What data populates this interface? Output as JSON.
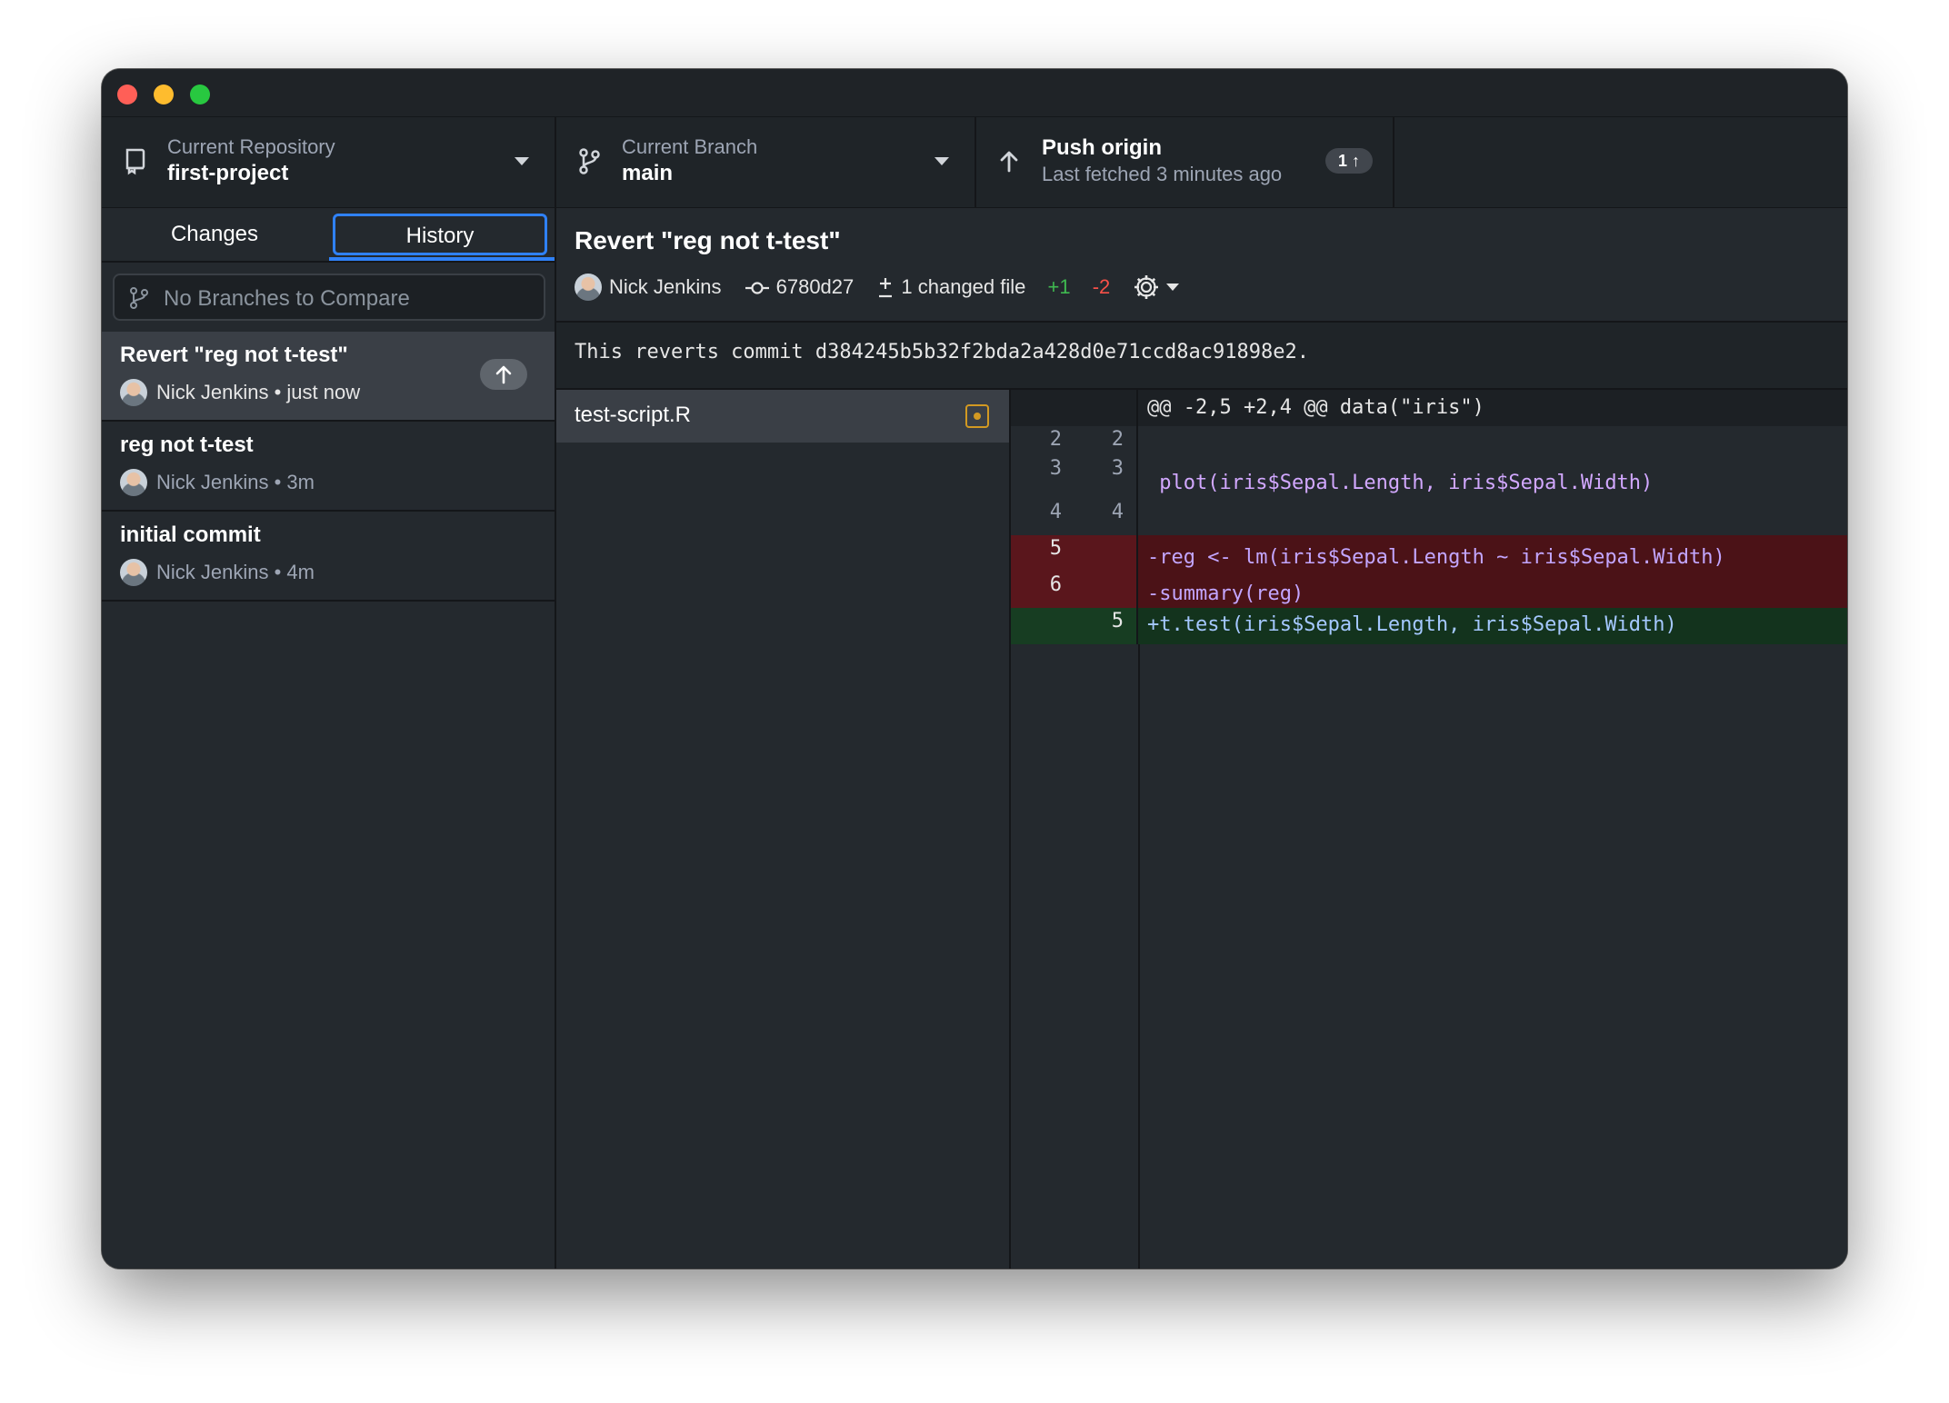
{
  "toolbar": {
    "repository_label": "Current Repository",
    "repository_name": "first-project",
    "branch_label": "Current Branch",
    "branch_name": "main",
    "push_title": "Push origin",
    "push_subtitle": "Last fetched 3 minutes ago",
    "push_badge": "1 ↑"
  },
  "sidebar": {
    "tabs": {
      "changes": "Changes",
      "history": "History"
    },
    "compare_placeholder": "No Branches to Compare",
    "commits": [
      {
        "title": "Revert \"reg not t-test\"",
        "meta": "Nick Jenkins • just now",
        "selected": true
      },
      {
        "title": "reg not t-test",
        "meta": "Nick Jenkins • 3m",
        "selected": false
      },
      {
        "title": "initial commit",
        "meta": "Nick Jenkins • 4m",
        "selected": false
      }
    ]
  },
  "commit": {
    "title": "Revert \"reg not t-test\"",
    "author": "Nick Jenkins",
    "sha": "6780d27",
    "changed_files": "1 changed file",
    "additions": "+1",
    "deletions": "-2",
    "message": "This reverts commit d384245b5b32f2bda2a428d0e71ccd8ac91898e2."
  },
  "files": [
    {
      "name": "test-script.R",
      "status": "modified"
    }
  ],
  "diff": {
    "hunk_header": "@@ -2,5 +2,4 @@ data(\"iris\")",
    "lines": [
      {
        "old": "2",
        "new": "2",
        "text": ""
      },
      {
        "old": "3",
        "new": "3",
        "text": " plot(iris$Sepal.Length, iris$Sepal.Width)"
      },
      {
        "old": "4",
        "new": "4",
        "text": ""
      },
      {
        "old": "5",
        "new": "",
        "text": "-reg <- lm(iris$Sepal.Length ~ iris$Sepal.Width)"
      },
      {
        "old": "6",
        "new": "",
        "text": "-summary(reg)"
      },
      {
        "old": "",
        "new": "5",
        "text": "+t.test(iris$Sepal.Length, iris$Sepal.Width)"
      }
    ]
  },
  "colors": {
    "accent": "#2f81f7",
    "addition": "#3fb950",
    "deletion": "#f85149",
    "modified": "#d29922"
  }
}
